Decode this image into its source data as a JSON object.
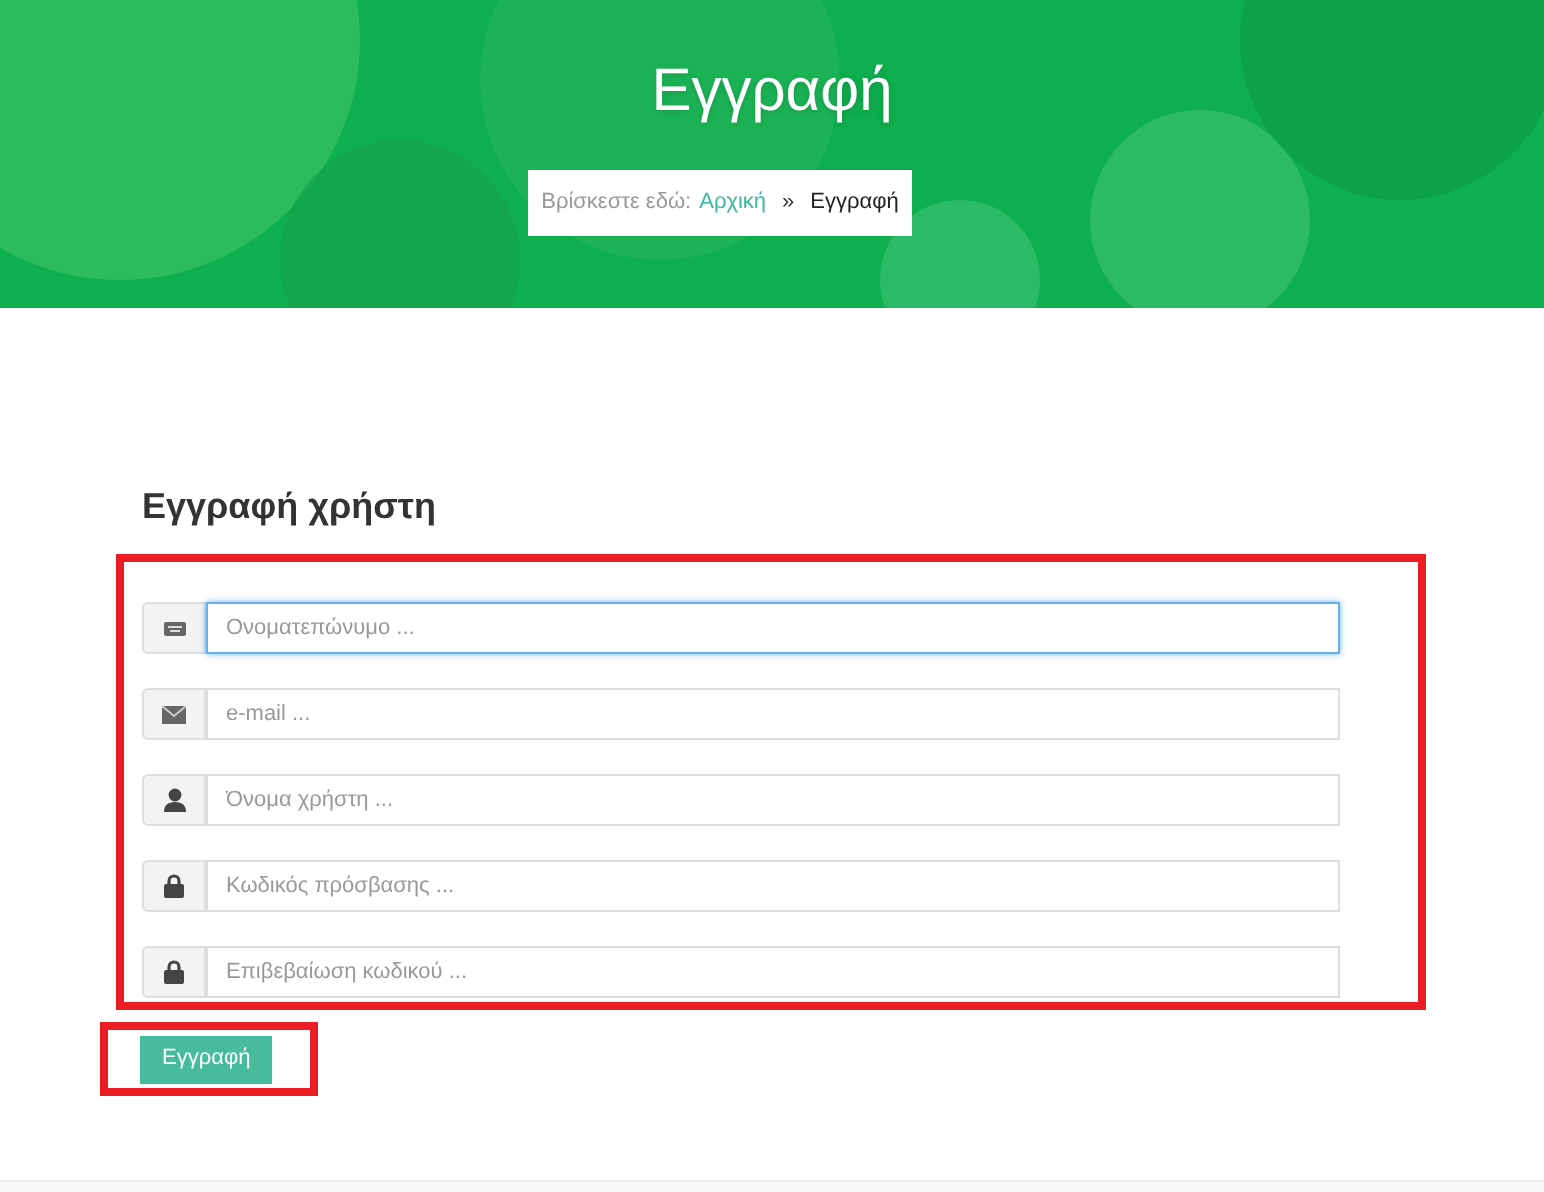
{
  "hero": {
    "title": "Εγγραφή",
    "breadcrumb": {
      "prefix": "Βρίσκεστε εδώ:",
      "items": [
        {
          "label": "Αρχική",
          "kind": "link"
        },
        {
          "label": "Εγγραφή",
          "kind": "current"
        }
      ],
      "separator": "»"
    }
  },
  "form": {
    "heading": "Εγγραφή χρήστη",
    "fields": [
      {
        "kind": "keyboard",
        "placeholder": "Ονοματεπώνυμο ...",
        "focused": true
      },
      {
        "kind": "mail",
        "placeholder": "e-mail ...",
        "focused": false
      },
      {
        "kind": "user",
        "placeholder": "Όνομα χρήστη ...",
        "focused": false
      },
      {
        "kind": "lock",
        "placeholder": "Κωδικός πρόσβασης ...",
        "focused": false
      },
      {
        "kind": "lock",
        "placeholder": "Επιβεβαίωση κωδικού ...",
        "focused": false
      }
    ],
    "submit": "Εγγραφή"
  }
}
